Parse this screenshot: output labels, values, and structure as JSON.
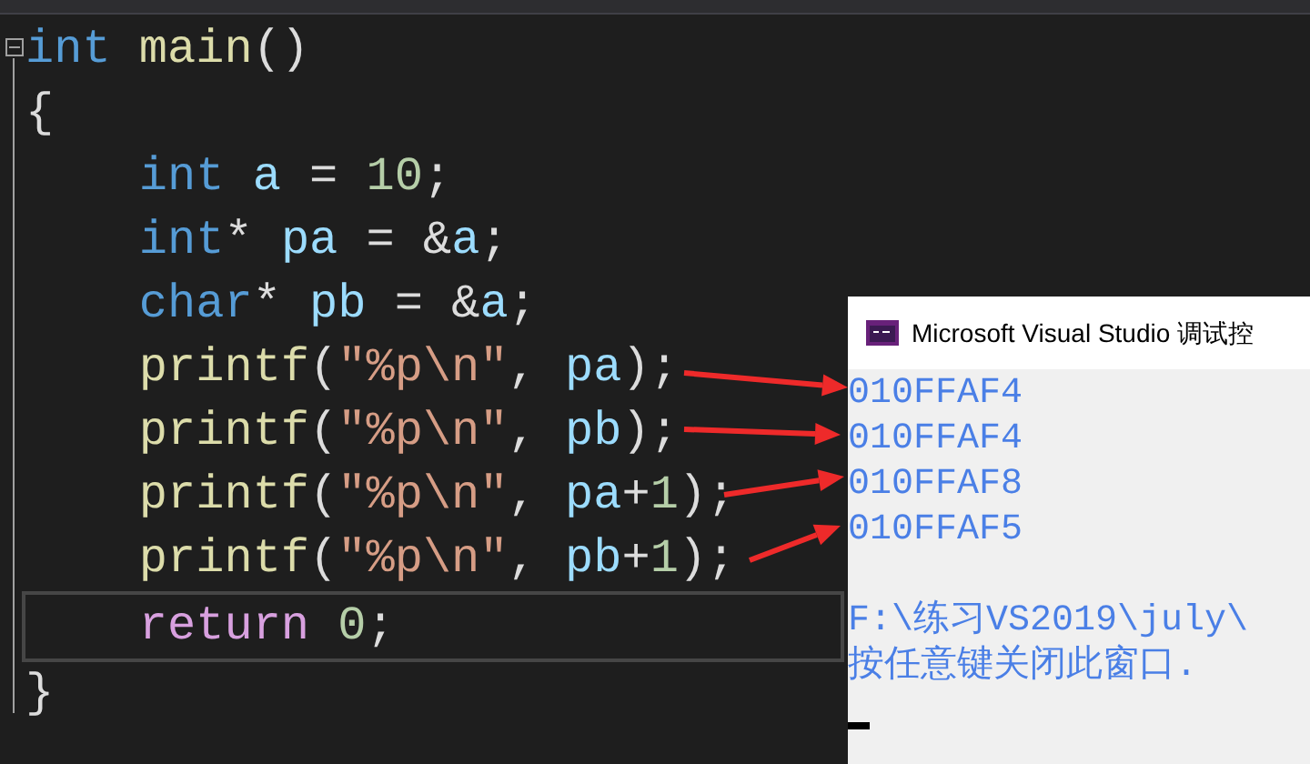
{
  "code": {
    "header": {
      "highlighted": false,
      "tokens": [
        {
          "kind": "keyword",
          "text": "int"
        },
        {
          "kind": "function",
          "text": " main"
        },
        {
          "kind": "plain",
          "text": "()"
        }
      ]
    },
    "open_brace": {
      "highlighted": false,
      "tokens": [
        {
          "kind": "plain",
          "text": "{"
        }
      ]
    },
    "body": [
      {
        "highlighted": false,
        "tokens": [
          {
            "kind": "keyword",
            "text": "int"
          },
          {
            "kind": "variable",
            "text": " a"
          },
          {
            "kind": "plain",
            "text": " = "
          },
          {
            "kind": "number",
            "text": "10"
          },
          {
            "kind": "plain",
            "text": ";"
          }
        ]
      },
      {
        "highlighted": false,
        "tokens": [
          {
            "kind": "keyword",
            "text": "int"
          },
          {
            "kind": "plain",
            "text": "* "
          },
          {
            "kind": "variable",
            "text": "pa"
          },
          {
            "kind": "plain",
            "text": " = &"
          },
          {
            "kind": "variable",
            "text": "a"
          },
          {
            "kind": "plain",
            "text": ";"
          }
        ]
      },
      {
        "highlighted": false,
        "tokens": [
          {
            "kind": "keyword",
            "text": "char"
          },
          {
            "kind": "plain",
            "text": "* "
          },
          {
            "kind": "variable",
            "text": "pb"
          },
          {
            "kind": "plain",
            "text": " = &"
          },
          {
            "kind": "variable",
            "text": "a"
          },
          {
            "kind": "plain",
            "text": ";"
          }
        ]
      },
      {
        "highlighted": false,
        "tokens": [
          {
            "kind": "function",
            "text": "printf"
          },
          {
            "kind": "plain",
            "text": "("
          },
          {
            "kind": "string",
            "text": "\"%p\\n\""
          },
          {
            "kind": "plain",
            "text": ", "
          },
          {
            "kind": "variable",
            "text": "pa"
          },
          {
            "kind": "plain",
            "text": ");"
          }
        ]
      },
      {
        "highlighted": false,
        "tokens": [
          {
            "kind": "function",
            "text": "printf"
          },
          {
            "kind": "plain",
            "text": "("
          },
          {
            "kind": "string",
            "text": "\"%p\\n\""
          },
          {
            "kind": "plain",
            "text": ", "
          },
          {
            "kind": "variable",
            "text": "pb"
          },
          {
            "kind": "plain",
            "text": ");"
          }
        ]
      },
      {
        "highlighted": false,
        "tokens": [
          {
            "kind": "function",
            "text": "printf"
          },
          {
            "kind": "plain",
            "text": "("
          },
          {
            "kind": "string",
            "text": "\"%p\\n\""
          },
          {
            "kind": "plain",
            "text": ", "
          },
          {
            "kind": "variable",
            "text": "pa"
          },
          {
            "kind": "plain",
            "text": "+"
          },
          {
            "kind": "number",
            "text": "1"
          },
          {
            "kind": "plain",
            "text": ");"
          }
        ]
      },
      {
        "highlighted": false,
        "tokens": [
          {
            "kind": "function",
            "text": "printf"
          },
          {
            "kind": "plain",
            "text": "("
          },
          {
            "kind": "string",
            "text": "\"%p\\n\""
          },
          {
            "kind": "plain",
            "text": ", "
          },
          {
            "kind": "variable",
            "text": "pb"
          },
          {
            "kind": "plain",
            "text": "+"
          },
          {
            "kind": "number",
            "text": "1"
          },
          {
            "kind": "plain",
            "text": ");"
          }
        ]
      },
      {
        "highlighted": true,
        "tokens": [
          {
            "kind": "keyword_control",
            "text": "return"
          },
          {
            "kind": "number",
            "text": " 0"
          },
          {
            "kind": "plain",
            "text": ";"
          }
        ]
      }
    ],
    "close_brace": {
      "highlighted": false,
      "tokens": [
        {
          "kind": "plain",
          "text": "}"
        }
      ]
    }
  },
  "console": {
    "title": "Microsoft Visual Studio 调试控",
    "output_lines": [
      {
        "text": "010FFAF4"
      },
      {
        "text": "010FFAF4"
      },
      {
        "text": "010FFAF8"
      },
      {
        "text": "010FFAF5",
        "gap_after": true
      },
      {
        "text": "F:\\练习VS2019\\july\\"
      },
      {
        "text": "按任意键关闭此窗口."
      }
    ]
  }
}
